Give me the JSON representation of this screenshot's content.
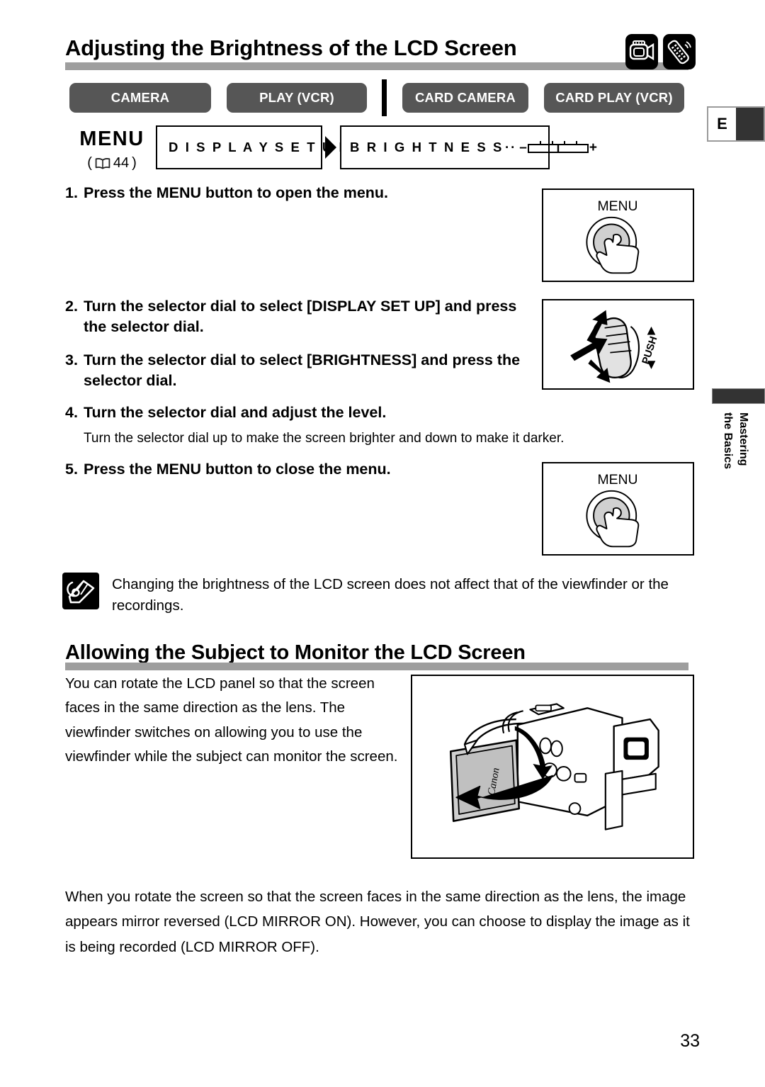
{
  "header": {
    "title": "Adjusting the Brightness of the LCD Screen",
    "icons": [
      {
        "name": "camcorder-icon",
        "label": "camcorder"
      },
      {
        "name": "remote-control-icon",
        "label": "remote control"
      }
    ]
  },
  "mode_buttons": [
    {
      "label": "CAMERA"
    },
    {
      "label": "PLAY (VCR)"
    },
    {
      "label": "CARD CAMERA"
    },
    {
      "label": "CARD PLAY (VCR)"
    }
  ],
  "language_tab": {
    "letter": "E"
  },
  "side_tab": {
    "line1": "Mastering",
    "line2": "the Basics"
  },
  "menu_path": {
    "menu_word": "MENU",
    "reference_page": "44",
    "reference_open": "(",
    "reference_close": ")",
    "first_item": "D I S P L A Y   S E T   U P",
    "second_item": "B R I G H T N E S S",
    "second_dots": "··",
    "slider_minus": "–",
    "slider_plus": "+"
  },
  "steps": [
    {
      "num": "1.",
      "text": "Press the MENU button to open the menu."
    },
    {
      "num": "2.",
      "text": "Turn the selector dial to select [DISPLAY SET UP] and press the selector dial."
    },
    {
      "num": "3.",
      "text": "Turn the selector dial to select [BRIGHTNESS] and press the selector dial."
    },
    {
      "num": "4.",
      "text": "Turn the selector dial and adjust the level."
    },
    {
      "num": "5.",
      "text": "Press the MENU button to close the menu."
    }
  ],
  "step4_note": "Turn the selector dial up to make the screen brighter and down to make it darker.",
  "illustrations": {
    "menu_button_label": "MENU",
    "dial_push_label": "PUSH",
    "camcorder_brand": "Canon"
  },
  "note": {
    "text": "Changing the brightness of the LCD screen does not affect that of the viewfinder or the recordings."
  },
  "section2": {
    "title": "Allowing the Subject to Monitor the LCD Screen",
    "body_left": "You can rotate the LCD panel so that the screen faces in the same direction as the lens. The viewfinder switches on allowing you to use the viewfinder while the subject can monitor the screen.",
    "body_bottom": "When you rotate the screen so that the screen faces in the same direction as the lens, the image appears mirror reversed (LCD MIRROR ON). However, you can choose to display the image as it is being recorded (LCD MIRROR OFF)."
  },
  "page_number": "33",
  "colors": {
    "mode_button_bg": "#565656",
    "rule": "#9e9e9e",
    "tab_dark": "#333333",
    "ink": "#000000"
  }
}
